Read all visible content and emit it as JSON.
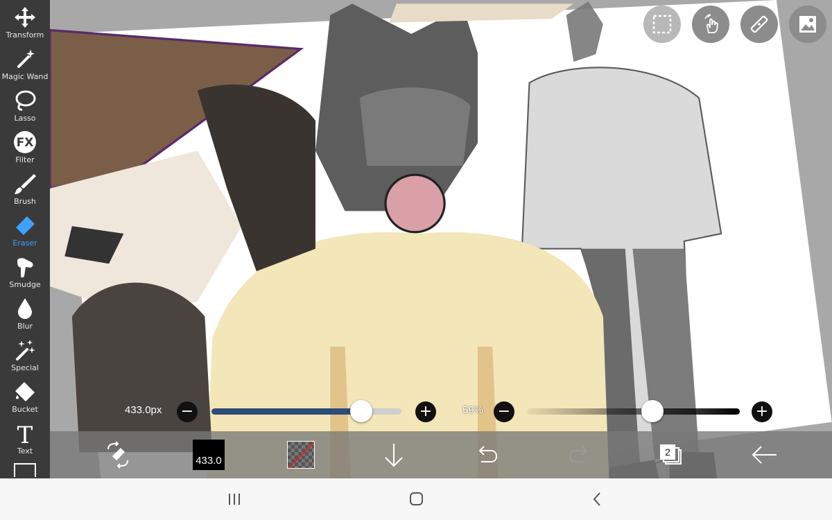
{
  "toolbar": {
    "tools": [
      {
        "label": "Transform",
        "icon": "move-arrows-icon",
        "active": false
      },
      {
        "label": "Magic Wand",
        "icon": "magic-wand-icon",
        "active": false
      },
      {
        "label": "Lasso",
        "icon": "lasso-icon",
        "active": false
      },
      {
        "label": "Filter",
        "icon": "fx-icon",
        "active": false
      },
      {
        "label": "Brush",
        "icon": "brush-icon",
        "active": false
      },
      {
        "label": "Eraser",
        "icon": "eraser-icon",
        "active": true
      },
      {
        "label": "Smudge",
        "icon": "smudge-icon",
        "active": false
      },
      {
        "label": "Blur",
        "icon": "blur-drop-icon",
        "active": false
      },
      {
        "label": "Special",
        "icon": "special-sparkle-icon",
        "active": false
      },
      {
        "label": "Bucket",
        "icon": "bucket-icon",
        "active": false
      },
      {
        "label": "Text",
        "icon": "text-icon",
        "active": false
      }
    ],
    "filter_icon_text": "FX",
    "text_icon_text": "T"
  },
  "top_buttons": [
    "selection-icon",
    "touch-gesture-icon",
    "ruler-icon",
    "image-material-icon"
  ],
  "brush_size": {
    "value_label": "433.0px",
    "fraction": 0.79
  },
  "opacity": {
    "value_label": "59%",
    "fraction": 0.59
  },
  "bottom_bar": {
    "brush_preview_value": "433.0",
    "layers_count": "2"
  },
  "colors": {
    "accent": "#3ea0ff",
    "slider_fill": "#2e4c78",
    "toolbar_bg": "#3a3a3a"
  }
}
